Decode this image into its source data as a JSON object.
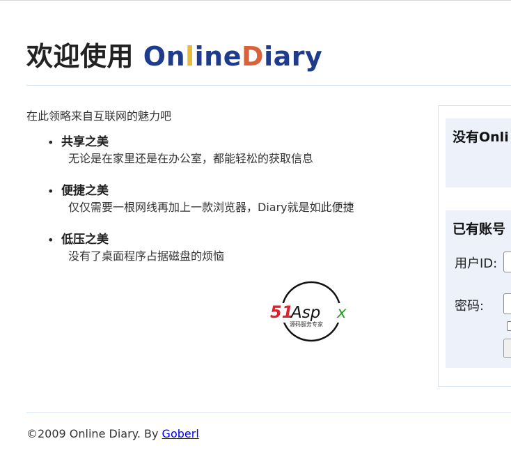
{
  "header": {
    "welcome": "欢迎使用",
    "brand": [
      {
        "text": "O",
        "color": "#1f3c8c"
      },
      {
        "text": "n",
        "color": "#1f3c8c"
      },
      {
        "text": "l",
        "color": "#e8b93a"
      },
      {
        "text": "ine",
        "color": "#1f3c8c"
      },
      {
        "text": "D",
        "color": "#d9623b"
      },
      {
        "text": "iary",
        "color": "#1f3c8c"
      }
    ]
  },
  "intro": "在此领略来自互联网的魅力吧",
  "features": [
    {
      "title": "共享之美",
      "desc": "无论是在家里还是在办公室，都能轻松的获取信息"
    },
    {
      "title": "便捷之美",
      "desc": "仅仅需要一根网线再加上一款浏览器，Diary就是如此便捷"
    },
    {
      "title": "低压之美",
      "desc": "没有了桌面程序占据磁盘的烦恼"
    }
  ],
  "logo": {
    "text_main": "51Aspx",
    "text_sub": "源码服务专家",
    "colors": {
      "red": "#d9232d",
      "green": "#2aa02a",
      "black": "#111111"
    }
  },
  "sidebar": {
    "register": {
      "heading": "没有Onli"
    },
    "login": {
      "heading": "已有账号",
      "user_label": "用户ID:",
      "password_label": "密码:"
    }
  },
  "footer": {
    "copyright": "©2009 Online Diary. By ",
    "author_link": "Goberl"
  }
}
